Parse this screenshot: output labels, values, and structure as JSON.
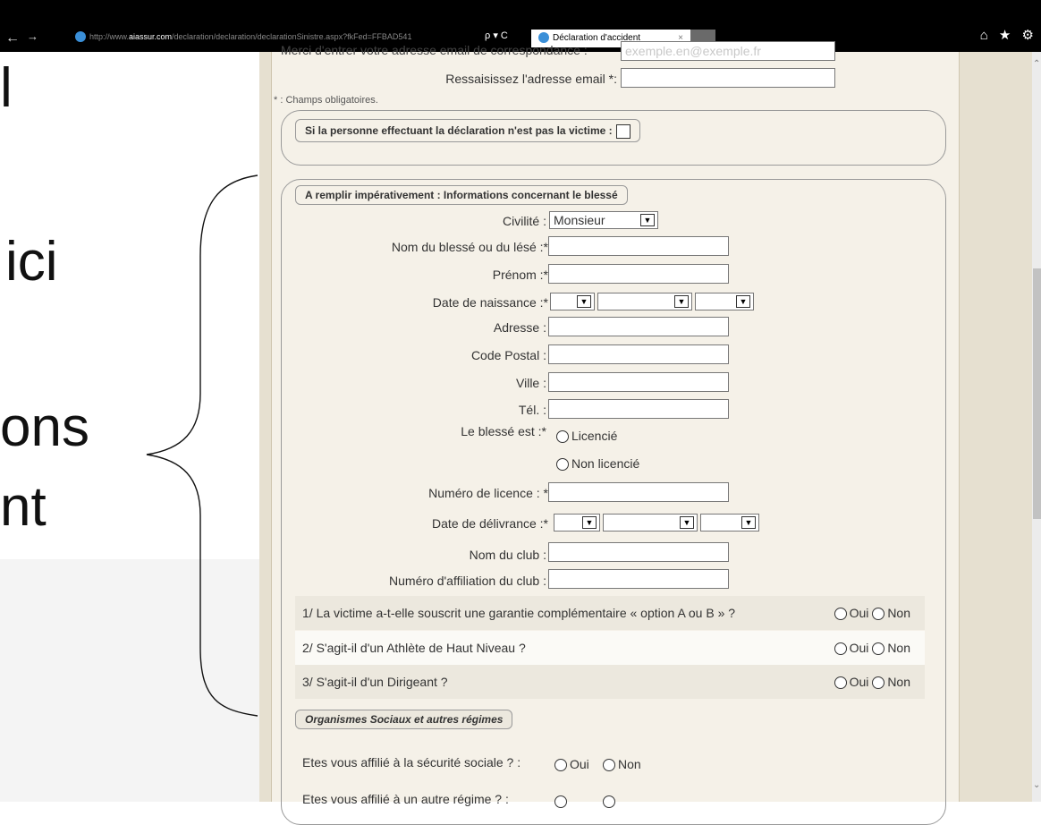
{
  "browser": {
    "back": "←",
    "forward": "→",
    "url_prefix": "http://www.",
    "url_domain": "aiassur.com",
    "url_path": "/declaration/declaration/declarationSinistre.aspx?fkFed=FFBAD541",
    "search_refresh": "ρ ▾ C",
    "tab_title": "Déclaration d'accident",
    "tab_close": "×",
    "icons": "⌂ ★ ⚙"
  },
  "slide": {
    "fragment_1": "l",
    "fragment_2": "ici",
    "fragment_3": "ons",
    "fragment_4": "nt"
  },
  "form": {
    "top_cut_label": "Merci d'entrer votre adresse email de correspondance :",
    "top_cut_value": "exemple.en@exemple.fr",
    "email_confirm_label": "Ressaisissez l'adresse email *:",
    "required_note": "* : Champs obligatoires.",
    "declarant_legend": "Si la personne effectuant la déclaration n'est pas la victime :",
    "injured_legend": "A remplir impérativement : Informations concernant le blessé",
    "civilite_label": "Civilité :",
    "civilite_value": "Monsieur",
    "nom_label": "Nom du blessé ou du lésé :*",
    "prenom_label": "Prénom :*",
    "naissance_label": "Date de naissance :*",
    "adresse_label": "Adresse :",
    "cp_label": "Code Postal :",
    "ville_label": "Ville :",
    "tel_label": "Tél. :",
    "statut_label": "Le blessé est :*",
    "licencie": "Licencié",
    "non_licencie": "Non licencié",
    "licence_label": "Numéro de licence : *",
    "delivrance_label": "Date de délivrance :*",
    "club_label": "Nom du club :",
    "affiliation_label": "Numéro d'affiliation du club :",
    "q1": "1/ La victime a-t-elle souscrit une garantie complémentaire « option A ou B » ?",
    "q2": "2/ S'agit-il d'un Athlète de Haut Niveau ?",
    "q3": "3/ S'agit-il d'un Dirigeant ?",
    "oui": "Oui",
    "non": "Non",
    "social_legend": "Organismes Sociaux et autres régimes",
    "secu_label": "Etes vous affilié à la sécurité sociale ? :",
    "autre_label": "Etes vous affilié à un autre régime ? :"
  }
}
